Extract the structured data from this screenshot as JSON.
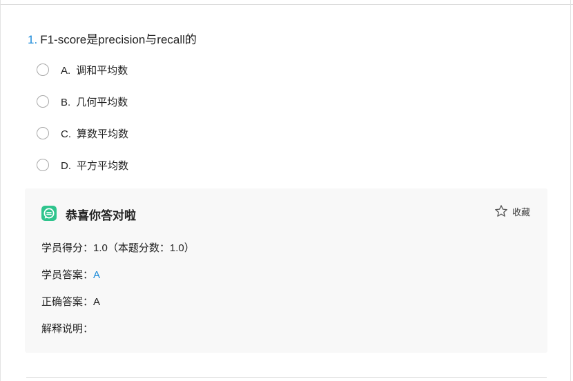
{
  "question": {
    "number": "1.",
    "text": "F1-score是precision与recall的"
  },
  "options": [
    {
      "letter": "A.",
      "text": "调和平均数",
      "selected": false
    },
    {
      "letter": "B.",
      "text": "几何平均数",
      "selected": false
    },
    {
      "letter": "C.",
      "text": "算数平均数",
      "selected": false
    },
    {
      "letter": "D.",
      "text": "平方平均数",
      "selected": false
    }
  ],
  "result": {
    "icon": "chat-bubble-icon",
    "title": "恭喜你答对啦",
    "collect_icon": "star-icon",
    "collect_label": "收藏",
    "score_label": "学员得分：",
    "score_value": "1.0（本题分数：1.0）",
    "student_answer_label": "学员答案：",
    "student_answer_value": "A",
    "correct_answer_label": "正确答案：",
    "correct_answer_value": "A",
    "explanation_label": "解释说明："
  },
  "colors": {
    "accent": "#1a8ad9",
    "success_icon": "#2fc48d",
    "panel_bg": "#f8f8f8"
  }
}
